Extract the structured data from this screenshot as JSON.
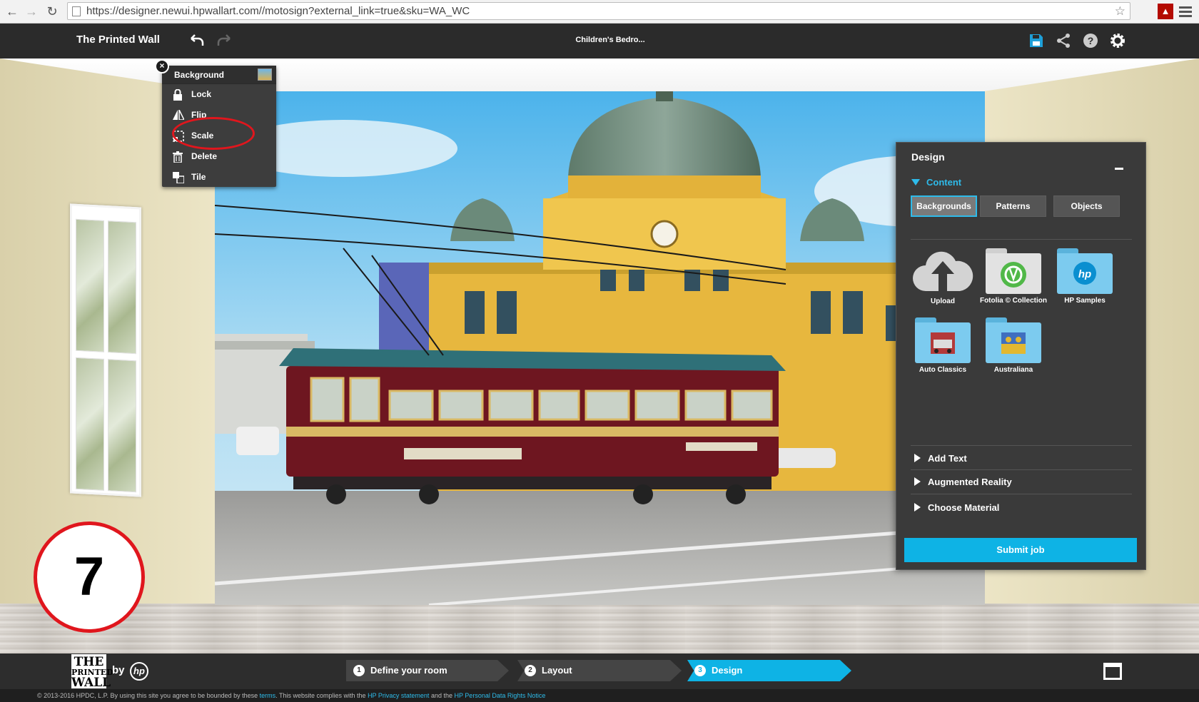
{
  "browser": {
    "url": "https://designer.newui.hpwallart.com//motosign?external_link=true&sku=WA_WC"
  },
  "header": {
    "app_title": "The Printed Wall",
    "document_title": "Children's Bedro..."
  },
  "context_menu": {
    "title": "Background",
    "items": [
      {
        "label": "Lock",
        "icon": "lock-icon"
      },
      {
        "label": "Flip",
        "icon": "flip-icon"
      },
      {
        "label": "Scale",
        "icon": "scale-icon"
      },
      {
        "label": "Delete",
        "icon": "trash-icon"
      },
      {
        "label": "Tile",
        "icon": "tile-icon"
      }
    ]
  },
  "step_badge": {
    "number": "7"
  },
  "design_panel": {
    "title": "Design",
    "content_label": "Content",
    "tabs": [
      {
        "label": "Backgrounds",
        "active": true
      },
      {
        "label": "Patterns",
        "active": false
      },
      {
        "label": "Objects",
        "active": false
      }
    ],
    "tiles": [
      {
        "label": "Upload",
        "icon": "cloud-upload-icon"
      },
      {
        "label": "Fotolia © Collection",
        "icon": "fotolia-folder-icon"
      },
      {
        "label": "HP Samples",
        "icon": "hp-folder-icon"
      },
      {
        "label": "Auto Classics",
        "icon": "auto-classics-folder-icon"
      },
      {
        "label": "Australiana",
        "icon": "australiana-folder-icon"
      }
    ],
    "accordion": [
      {
        "label": "Add Text"
      },
      {
        "label": "Augmented Reality"
      },
      {
        "label": "Choose Material"
      }
    ],
    "submit_label": "Submit job"
  },
  "footer": {
    "logo_lines": [
      "THE",
      "PRINTED",
      "WALL"
    ],
    "by": "by",
    "hp": "hp",
    "steps": [
      {
        "num": "1",
        "label": "Define your room"
      },
      {
        "num": "2",
        "label": "Layout"
      },
      {
        "num": "3",
        "label": "Design"
      }
    ],
    "legal": {
      "prefix": "© 2013-2016 HPDC, L.P.   By using this site you agree to be bounded by these ",
      "terms": "terms",
      "middle": ".  This website complies with the ",
      "privacy": "HP Privacy statement",
      "and": " and the ",
      "rights": "HP Personal Data Rights Notice"
    }
  },
  "colors": {
    "accent": "#0eb3e5",
    "annotation": "#e0161d",
    "panel_bg": "#3a3a3a"
  }
}
